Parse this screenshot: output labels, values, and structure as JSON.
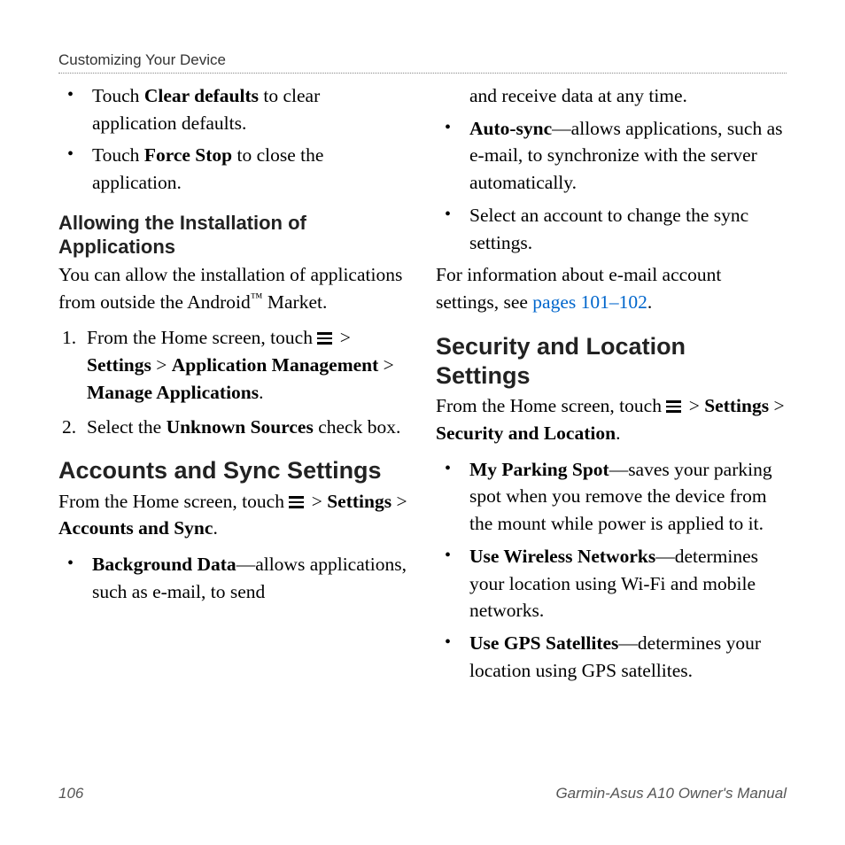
{
  "header": "Customizing Your Device",
  "left": {
    "bullets1": {
      "b1": {
        "pre": "Touch ",
        "bold": "Clear defaults",
        "post": " to clear application defaults."
      },
      "b2": {
        "pre": "Touch ",
        "bold": "Force Stop",
        "post": " to close the application."
      }
    },
    "subhead1": "Allowing the Installation of Applications",
    "para1_a": "You can allow the installation of applications from outside the Android",
    "para1_tm": "™",
    "para1_b": " Market.",
    "steps": {
      "s1": {
        "pre": "From the Home screen, touch ",
        "gt1": " > ",
        "b1": "Settings",
        "gt2": " > ",
        "b2": "Application Management",
        "gt3": " > ",
        "b3": "Manage Applications",
        "post": "."
      },
      "s2": {
        "pre": "Select the ",
        "bold": "Unknown Sources",
        "post": " check box."
      }
    },
    "mainhead1": "Accounts and Sync Settings",
    "para2": {
      "pre": "From the Home screen, touch ",
      "gt1": " > ",
      "b1": "Settings",
      "gt2": " > ",
      "b2": "Accounts and Sync",
      "post": "."
    },
    "bullets2": {
      "b1": {
        "bold": "Background Data",
        "post": "—allows applications, such as e-mail, to send"
      }
    }
  },
  "right": {
    "cont": "and receive data at any time.",
    "bullets1": {
      "b1": {
        "bold": "Auto-sync",
        "post": "—allows applications, such as e-mail, to synchronize with the server automatically."
      },
      "b2": {
        "text": "Select an account to change the sync settings."
      }
    },
    "para1": {
      "pre": "For information about e-mail account settings, see ",
      "link": "pages 101–102",
      "post": "."
    },
    "mainhead1": "Security and Location Settings",
    "para2": {
      "pre": "From the Home screen, touch ",
      "gt1": " > ",
      "b1": "Settings",
      "gt2": " > ",
      "b2": "Security and Location",
      "post": "."
    },
    "bullets2": {
      "b1": {
        "bold": "My Parking Spot",
        "post": "—saves your parking spot when you remove the device from the mount while power is applied to it."
      },
      "b2": {
        "bold": "Use Wireless Networks",
        "post": "—determines your location using Wi-Fi and mobile networks."
      },
      "b3": {
        "bold": "Use GPS Satellites",
        "post": "—determines your location using GPS satellites."
      }
    }
  },
  "footer": {
    "page": "106",
    "title": "Garmin-Asus A10 Owner's Manual"
  }
}
